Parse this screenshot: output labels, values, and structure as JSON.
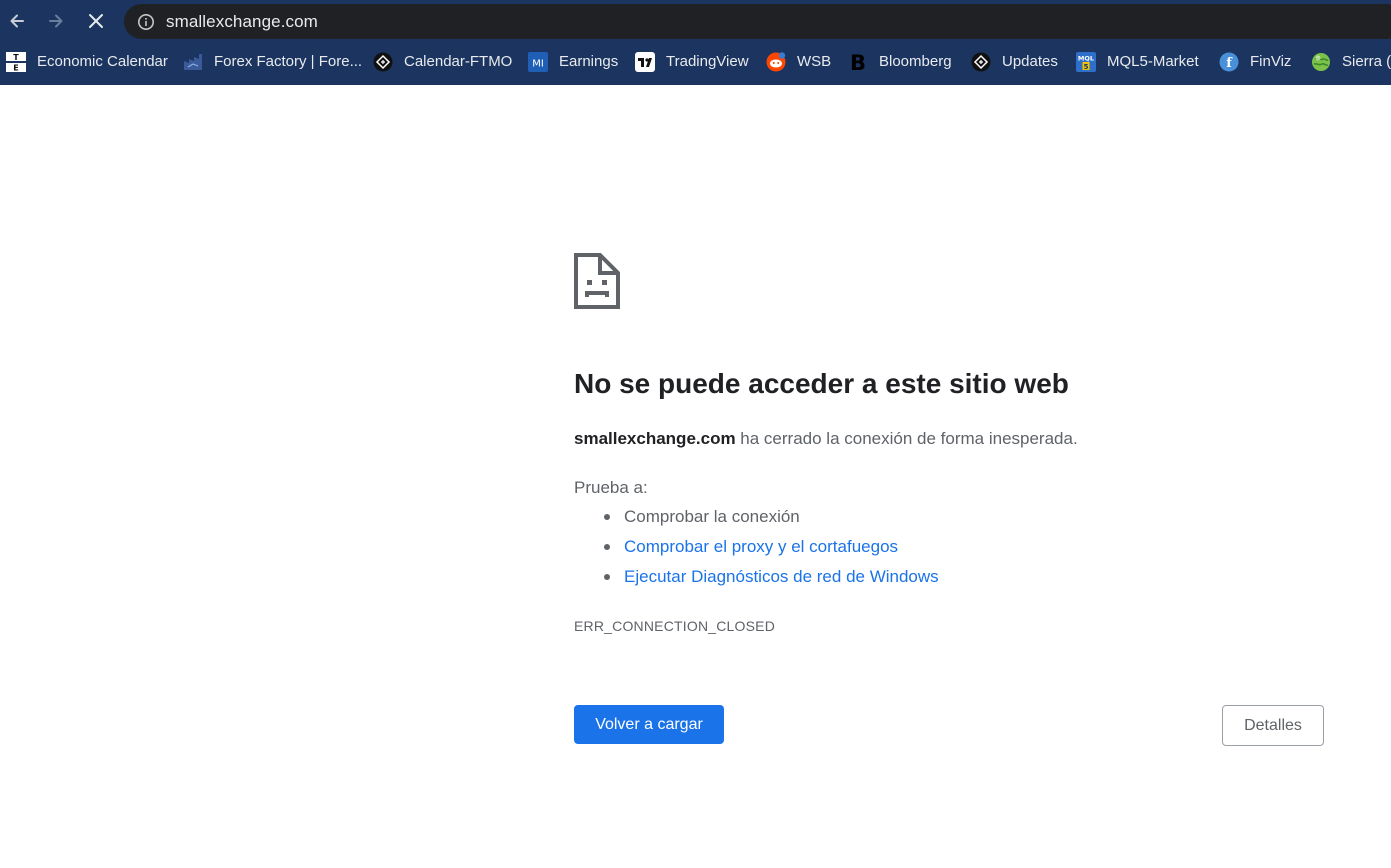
{
  "browser": {
    "url": "smallexchange.com",
    "loading": true,
    "colors": {
      "chrome": "#1b3560",
      "omnibox": "#202124",
      "accent": "#1a73e8"
    }
  },
  "bookmarks": [
    {
      "label": "Economic Calendar",
      "icon": "tradingeconomics-icon"
    },
    {
      "label": "Forex Factory | Fore...",
      "icon": "forexfactory-icon"
    },
    {
      "label": "Calendar-FTMO",
      "icon": "ftmo-icon"
    },
    {
      "label": "Earnings",
      "icon": "marketinsider-icon"
    },
    {
      "label": "TradingView",
      "icon": "tradingview-icon"
    },
    {
      "label": "WSB",
      "icon": "reddit-icon"
    },
    {
      "label": "Bloomberg",
      "icon": "bloomberg-icon"
    },
    {
      "label": "Updates",
      "icon": "ftmo-icon"
    },
    {
      "label": "MQL5-Market",
      "icon": "mql5-icon"
    },
    {
      "label": "FinViz",
      "icon": "finviz-icon"
    },
    {
      "label": "Sierra (A",
      "icon": "globe-icon"
    }
  ],
  "error": {
    "icon": "sad-document-icon",
    "title": "No se puede acceder a este sitio web",
    "host": "smallexchange.com",
    "message": " ha cerrado la conexión de forma inesperada.",
    "try_label": "Prueba a:",
    "suggestions": [
      {
        "text": "Comprobar la conexión",
        "link": false
      },
      {
        "text": "Comprobar el proxy y el cortafuegos",
        "link": true
      },
      {
        "text": "Ejecutar Diagnósticos de red de Windows",
        "link": true
      }
    ],
    "code": "ERR_CONNECTION_CLOSED",
    "reload_label": "Volver a cargar",
    "details_label": "Detalles"
  }
}
